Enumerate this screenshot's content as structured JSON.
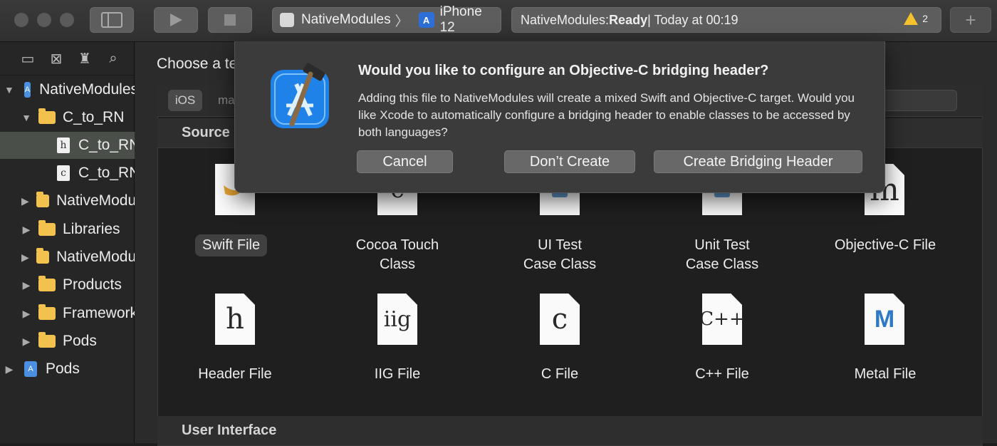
{
  "toolbar": {
    "scheme_name": "NativeModules",
    "device_name": "iPhone 12",
    "status_prefix": "NativeModules: ",
    "status_state": "Ready",
    "status_suffix": " | Today at 00:19",
    "warning_count": "2",
    "add_label": "+"
  },
  "navigator": {
    "items": [
      {
        "label": "NativeModules"
      },
      {
        "label": "C_to_RN"
      },
      {
        "label": "C_to_RN.h"
      },
      {
        "label": "C_to_RN.c"
      },
      {
        "label": "NativeModules"
      },
      {
        "label": "Libraries"
      },
      {
        "label": "NativeModules"
      },
      {
        "label": "Products"
      },
      {
        "label": "Frameworks"
      },
      {
        "label": "Pods"
      },
      {
        "label": "Pods"
      }
    ]
  },
  "chooser": {
    "heading": "Choose a template for your new file:",
    "platform_ios": "iOS",
    "platform_mac": "macOS",
    "section_source": "Source",
    "section_ui": "User Interface",
    "templates": [
      {
        "label": "Swift File",
        "glyph": ""
      },
      {
        "label": "Cocoa Touch\nClass",
        "glyph": "c"
      },
      {
        "label": "UI Test\nCase Class",
        "glyph": ""
      },
      {
        "label": "Unit Test\nCase Class",
        "glyph": ""
      },
      {
        "label": "Objective-C File",
        "glyph": "m"
      },
      {
        "label": "Header File",
        "glyph": "h"
      },
      {
        "label": "IIG File",
        "glyph": "iig"
      },
      {
        "label": "C File",
        "glyph": "c"
      },
      {
        "label": "C++ File",
        "glyph": "C++"
      },
      {
        "label": "Metal File",
        "glyph": "M"
      }
    ]
  },
  "alert": {
    "title": "Would you like to configure an Objective-C bridging header?",
    "message": "Adding this file to NativeModules will create a mixed Swift and Objective-C target. Would you like Xcode to automatically configure a bridging header to enable classes to be accessed by both languages?",
    "cancel": "Cancel",
    "dont_create": "Don’t Create",
    "create": "Create Bridging Header"
  },
  "colors": {
    "accent_blue": "#2d8cf0",
    "warning": "#f4c02b",
    "folder": "#f2c14e"
  }
}
